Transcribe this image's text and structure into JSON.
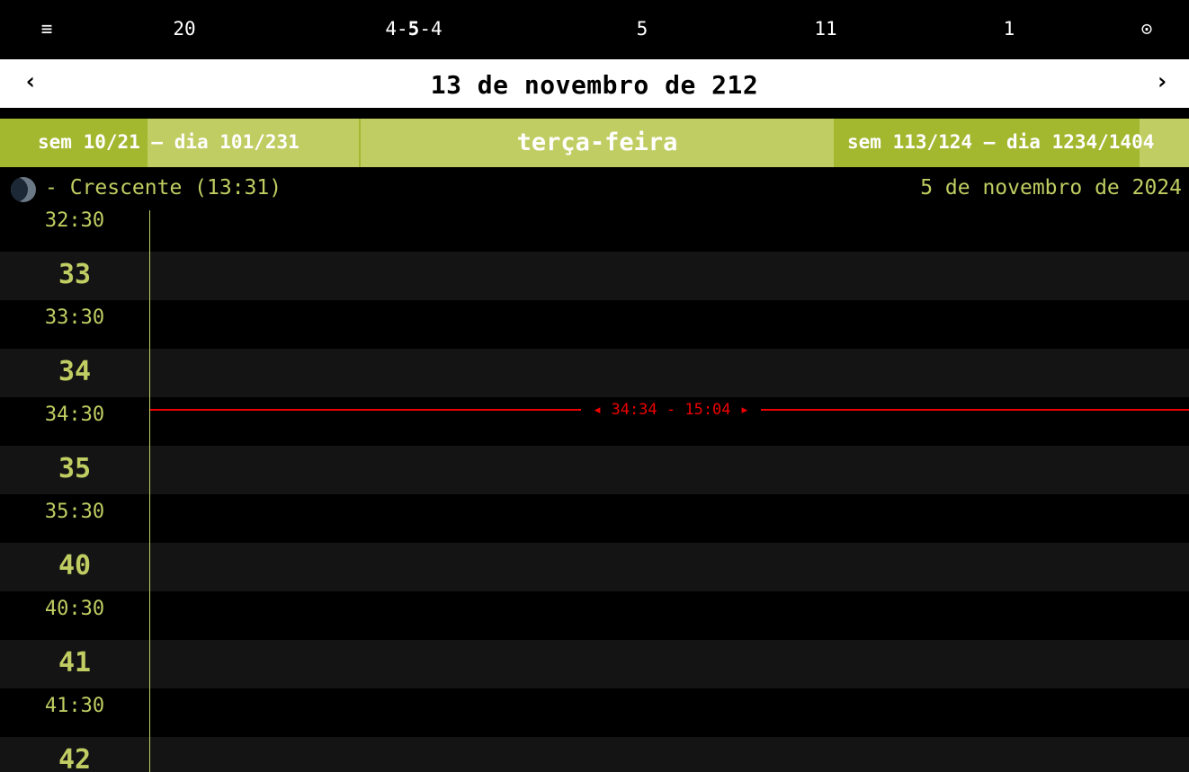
{
  "topbar": {
    "menu_icon": "≡",
    "item1": "20",
    "item2_pre": "4-",
    "item2_bold": "5",
    "item2_post": "-4",
    "item3": "5",
    "item4": "11",
    "item5": "1",
    "target_icon": "⊙"
  },
  "datebar": {
    "prev": "‹",
    "title": "13 de novembro de 212",
    "next": "›"
  },
  "weekbar": {
    "left_label": "sem 10/21 — dia 101/231",
    "weekday": "terça-feira",
    "right_label": "sem 113/124 — dia 1234/1404",
    "left_progress": 0.41,
    "right_progress": 0.86
  },
  "moon": {
    "phase_label": "- Crescente (13:31)",
    "gregorian_date": "5 de novembro de 2024"
  },
  "timeline": {
    "slots": [
      "32:30",
      "33",
      "33:30",
      "34",
      "34:30",
      "35",
      "35:30",
      "40",
      "40:30",
      "41",
      "41:30",
      "42"
    ],
    "now_label": "◂ 34:34 - 15:04 ▸"
  }
}
